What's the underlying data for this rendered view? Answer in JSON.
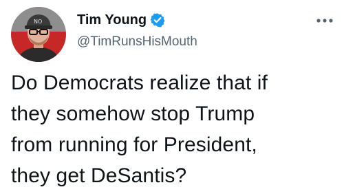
{
  "author": {
    "display_name": "Tim Young",
    "handle": "@TimRunsHisMouth",
    "verified": true,
    "avatar_icon": "user-avatar"
  },
  "tweet": {
    "text": "Do Democrats realize that if\nthey somehow stop Trump\nfrom running for President,\nthey get DeSantis?"
  },
  "icons": {
    "verified": "verified-badge-icon",
    "more": "more-options-icon"
  },
  "colors": {
    "verified_blue": "#1d9bf0",
    "text_primary": "#0f1419",
    "text_secondary": "#536471"
  }
}
